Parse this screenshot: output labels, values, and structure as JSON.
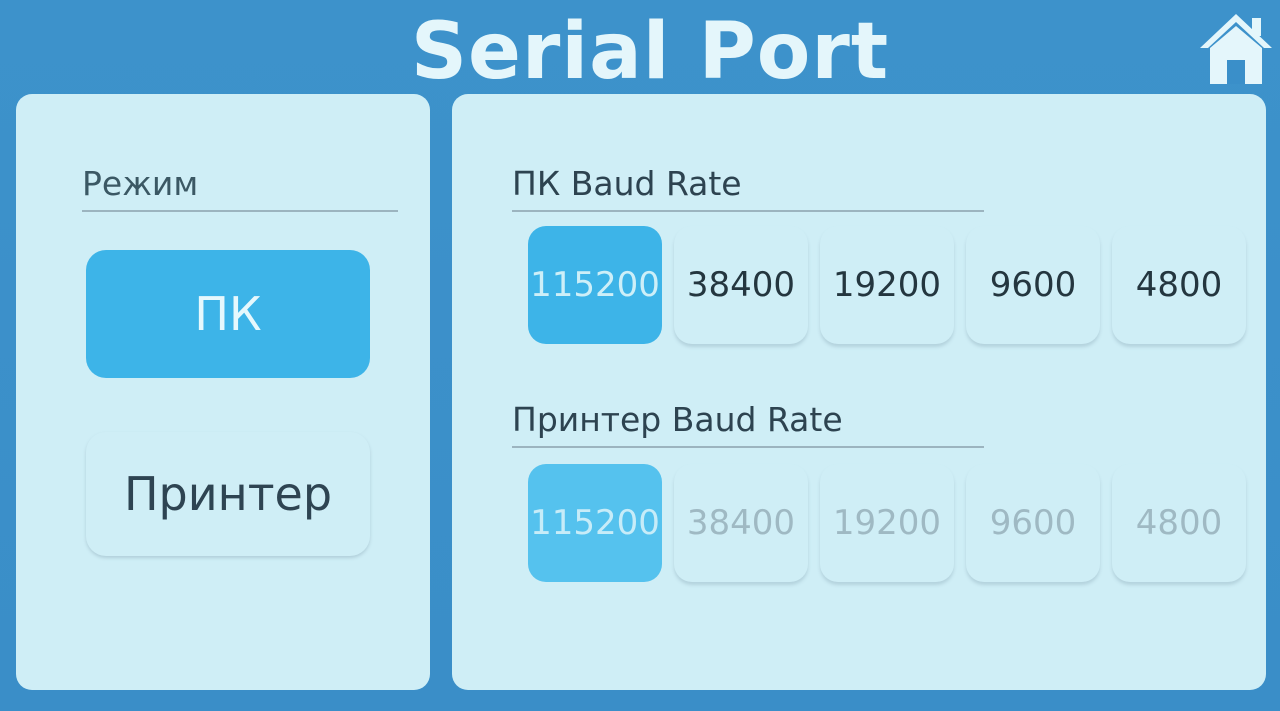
{
  "header": {
    "title": "Serial Port",
    "home_icon": "home-icon"
  },
  "mode_panel": {
    "label": "Режим",
    "options": [
      {
        "label": "ПК",
        "selected": true
      },
      {
        "label": "Принтер",
        "selected": false
      }
    ]
  },
  "pc_baud": {
    "label": "ПК Baud Rate",
    "options": [
      "115200",
      "38400",
      "19200",
      "9600",
      "4800"
    ],
    "selected": "115200"
  },
  "printer_baud": {
    "label": "Принтер Baud Rate",
    "options": [
      "115200",
      "38400",
      "19200",
      "9600",
      "4800"
    ],
    "selected": "115200",
    "disabled": true
  },
  "colors": {
    "background": "#3a8fc9",
    "panel": "#cfeef6",
    "accent": "#3db4e8",
    "title": "#e4f6fb"
  }
}
